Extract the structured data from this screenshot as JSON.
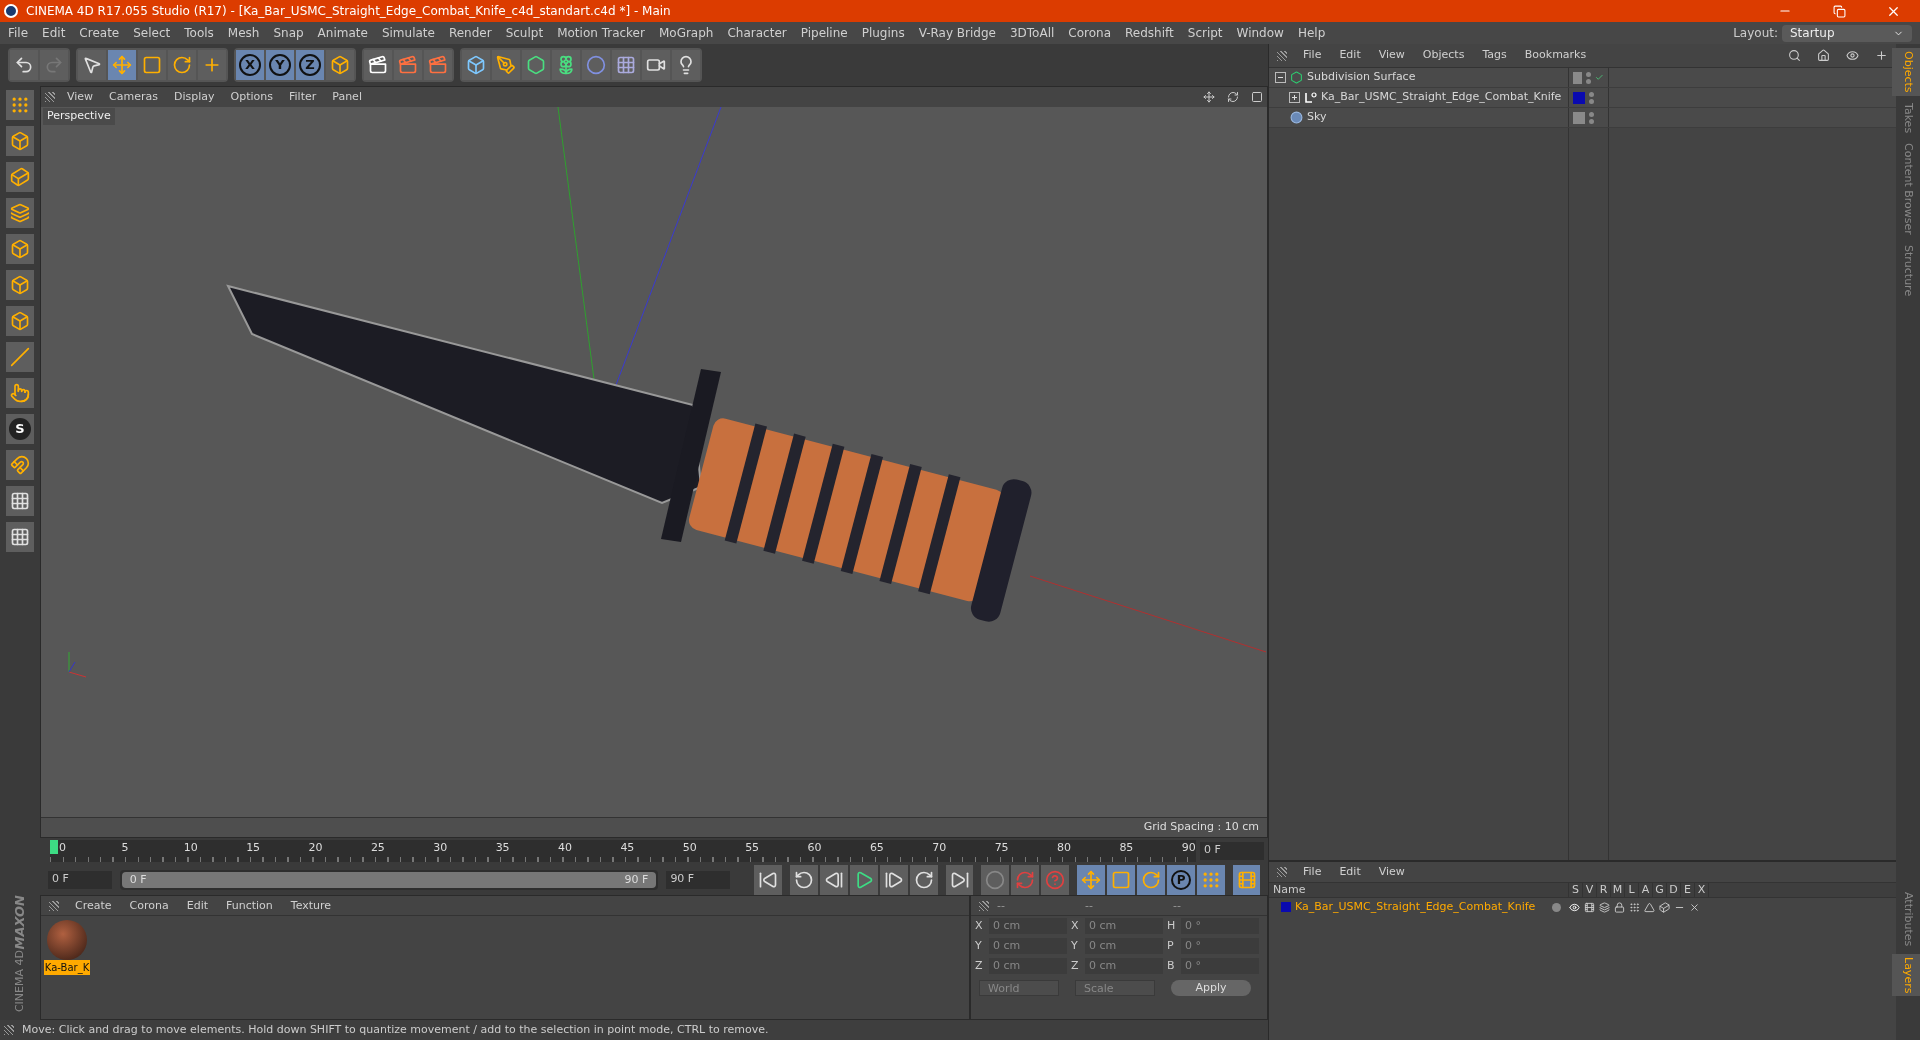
{
  "window": {
    "title": "CINEMA 4D R17.055 Studio (R17) - [Ka_Bar_USMC_Straight_Edge_Combat_Knife_c4d_standart.c4d *] - Main"
  },
  "menu_bar": [
    "File",
    "Edit",
    "Create",
    "Select",
    "Tools",
    "Mesh",
    "Snap",
    "Animate",
    "Simulate",
    "Render",
    "Sculpt",
    "Motion Tracker",
    "MoGraph",
    "Character",
    "Pipeline",
    "Plugins",
    "V-Ray Bridge",
    "3DToAll",
    "Corona",
    "Redshift",
    "Script",
    "Window",
    "Help"
  ],
  "layout": {
    "label": "Layout:",
    "value": "Startup"
  },
  "toolbar": {
    "axis_buttons": [
      "X",
      "Y",
      "Z"
    ]
  },
  "left_tools": {
    "snap_label": "S"
  },
  "viewport": {
    "menu": [
      "View",
      "Cameras",
      "Display",
      "Options",
      "Filter",
      "Panel"
    ],
    "camera": "Perspective",
    "grid_spacing": "Grid Spacing : 10 cm"
  },
  "timeline": {
    "ticks": [
      "0",
      "5",
      "10",
      "15",
      "20",
      "25",
      "30",
      "35",
      "40",
      "45",
      "50",
      "55",
      "60",
      "65",
      "70",
      "75",
      "80",
      "85",
      "90"
    ],
    "current_frame": "0 F",
    "start": "0 F",
    "range": {
      "start": "0 F",
      "end": "90 F",
      "level": 1
    },
    "end": "90 F",
    "keyframe_label": "P"
  },
  "material_manager": {
    "menu": [
      "Create",
      "Corona",
      "Edit",
      "Function",
      "Texture"
    ],
    "materials": [
      {
        "name": "Ka-Bar_K",
        "selected": true
      }
    ]
  },
  "brand": {
    "company": "MAXON",
    "product": "CINEMA 4D"
  },
  "coordinates": {
    "headers": [
      "--",
      "--",
      "--"
    ],
    "rows": [
      {
        "a": "X",
        "pos": "0 cm",
        "b": "X",
        "size": "0 cm",
        "c": "H",
        "rot": "0 °"
      },
      {
        "a": "Y",
        "pos": "0 cm",
        "b": "Y",
        "size": "0 cm",
        "c": "P",
        "rot": "0 °"
      },
      {
        "a": "Z",
        "pos": "0 cm",
        "b": "Z",
        "size": "0 cm",
        "c": "B",
        "rot": "0 °"
      }
    ],
    "dropdowns": [
      "World",
      "Scale"
    ],
    "apply": "Apply"
  },
  "status_bar": "Move: Click and drag to move elements. Hold down SHIFT to quantize movement / add to the selection in point mode, CTRL to remove.",
  "object_manager": {
    "menu": [
      "File",
      "Edit",
      "View",
      "Objects",
      "Tags",
      "Bookmarks"
    ],
    "objects": [
      {
        "name": "Subdivision Surface",
        "kind": "subdivision",
        "expanded": true,
        "enabled": true,
        "children": [
          {
            "name": "Ka_Bar_USMC_Straight_Edge_Combat_Knife",
            "kind": "null",
            "expanded": false,
            "color": "#0a0ab0"
          }
        ]
      },
      {
        "name": "Sky",
        "kind": "sky"
      }
    ]
  },
  "layer_manager": {
    "menu": [
      "File",
      "Edit",
      "View"
    ],
    "columns": [
      "Name",
      "S",
      "V",
      "R",
      "M",
      "L",
      "A",
      "G",
      "D",
      "E",
      "X"
    ],
    "layers": [
      {
        "name": "Ka_Bar_USMC_Straight_Edge_Combat_Knife",
        "color": "#0a0ab0"
      }
    ]
  },
  "side_tabs": [
    {
      "label": "Objects",
      "selected": true
    },
    {
      "label": "Takes",
      "selected": false
    },
    {
      "label": "Content Browser",
      "selected": false
    },
    {
      "label": "Structure",
      "selected": false
    }
  ],
  "side_tabs_bottom": [
    {
      "label": "Attributes",
      "selected": false
    },
    {
      "label": "Layers",
      "selected": true
    }
  ]
}
